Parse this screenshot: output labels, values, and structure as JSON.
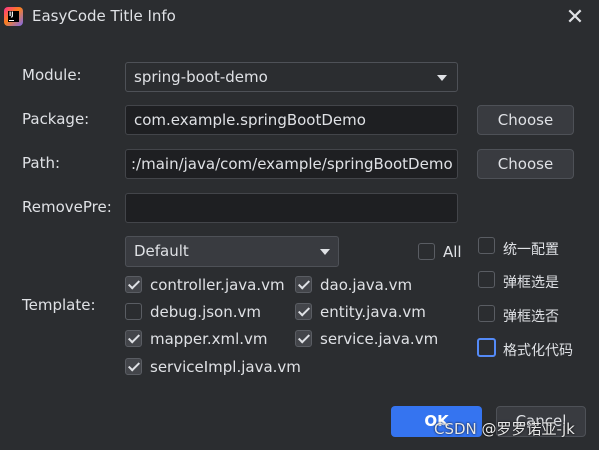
{
  "window": {
    "title": "EasyCode Title Info",
    "icon": "intellij-app-icon",
    "icon_text": "IJ",
    "close_icon": "close-icon"
  },
  "labels": {
    "module": "Module:",
    "package": "Package:",
    "path": "Path:",
    "remove_pre": "RemovePre:",
    "template": "Template:"
  },
  "module": {
    "value": "spring-boot-demo"
  },
  "package": {
    "value": "com.example.springBootDemo",
    "choose_label": "Choose"
  },
  "path": {
    "value": ":/main/java/com/example/springBootDemo",
    "choose_label": "Choose"
  },
  "remove_pre": {
    "value": ""
  },
  "template_group": {
    "value": "Default"
  },
  "all": {
    "label": "All",
    "checked": false
  },
  "templates": [
    {
      "label": "controller.java.vm",
      "checked": true
    },
    {
      "label": "dao.java.vm",
      "checked": true
    },
    {
      "label": "debug.json.vm",
      "checked": false
    },
    {
      "label": "entity.java.vm",
      "checked": true
    },
    {
      "label": "mapper.xml.vm",
      "checked": true
    },
    {
      "label": "service.java.vm",
      "checked": true
    },
    {
      "label": "serviceImpl.java.vm",
      "checked": true
    }
  ],
  "options": [
    {
      "label": "统一配置",
      "checked": false
    },
    {
      "label": "弹框选是",
      "checked": false
    },
    {
      "label": "弹框选否",
      "checked": false
    },
    {
      "label": "格式化代码",
      "checked": false,
      "focused": true
    }
  ],
  "buttons": {
    "ok": "OK",
    "cancel": "Cancel"
  },
  "watermark": "CSDN @罗罗诺亚-jk",
  "colors": {
    "accent": "#3574f0",
    "background": "#2b2d30",
    "field": "#1e1f22"
  }
}
